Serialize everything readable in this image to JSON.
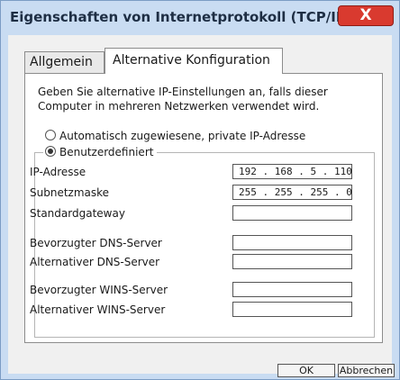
{
  "window": {
    "title": "Eigenschaften von Internetprotokoll (TCP/IP)",
    "close_label": "X"
  },
  "tabs": [
    {
      "label": "Allgemein",
      "selected": false
    },
    {
      "label": "Alternative Konfiguration",
      "selected": true
    }
  ],
  "description": "Geben Sie alternative IP-Einstellungen an, falls dieser Computer in mehreren Netzwerken verwendet wird.",
  "options": {
    "automatic_label": "Automatisch zugewiesene, private IP-Adresse",
    "custom_label": "Benutzerdefiniert",
    "selected": "custom"
  },
  "fields": {
    "ip_label": "IP-Adresse",
    "ip_value": "192 . 168 .  5  . 110",
    "subnet_label": "Subnetzmaske",
    "subnet_value": "255 . 255 . 255 .  0",
    "gateway_label": "Standardgateway",
    "gateway_value": "",
    "pref_dns_label": "Bevorzugter DNS-Server",
    "pref_dns_value": "",
    "alt_dns_label": "Alternativer DNS-Server",
    "alt_dns_value": "",
    "pref_wins_label": "Bevorzugter WINS-Server",
    "pref_wins_value": "",
    "alt_wins_label": "Alternativer WINS-Server",
    "alt_wins_value": ""
  },
  "buttons": {
    "ok_label": "OK",
    "cancel_label": "Abbrechen"
  },
  "colors": {
    "titlebar": "#c9dcf2",
    "close_button": "#d93a2f"
  }
}
